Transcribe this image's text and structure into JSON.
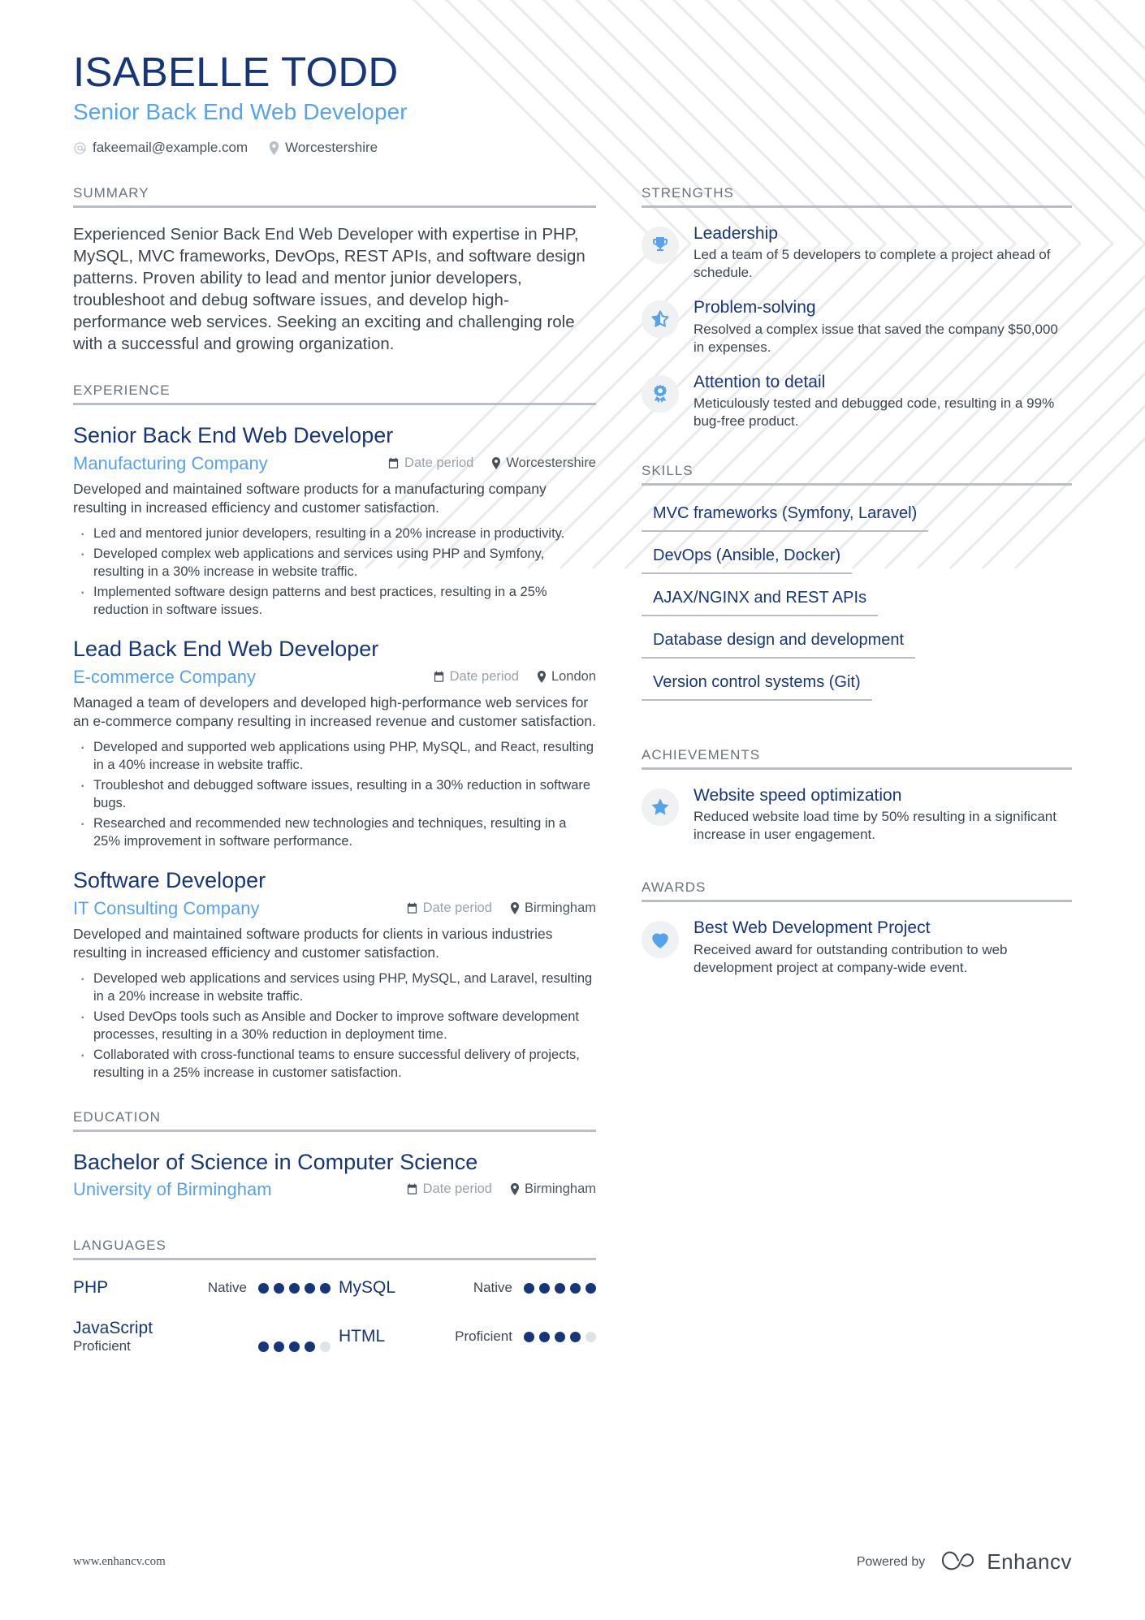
{
  "header": {
    "name": "ISABELLE TODD",
    "job_title": "Senior Back End Web Developer",
    "email": "fakeemail@example.com",
    "location": "Worcestershire",
    "email_icon": "at-icon",
    "location_icon": "map-pin-icon"
  },
  "sections": {
    "summary_label": "SUMMARY",
    "experience_label": "EXPERIENCE",
    "education_label": "EDUCATION",
    "languages_label": "LANGUAGES",
    "strengths_label": "STRENGTHS",
    "skills_label": "SKILLS",
    "achievements_label": "ACHIEVEMENTS",
    "awards_label": "AWARDS"
  },
  "summary": {
    "text": "Experienced Senior Back End Web Developer with expertise in PHP, MySQL, MVC frameworks, DevOps, REST APIs, and software design patterns. Proven ability to lead and mentor junior developers, troubleshoot and debug software issues, and develop high-performance web services. Seeking an exciting and challenging role with a successful and growing organization."
  },
  "experience": [
    {
      "role": "Senior Back End Web Developer",
      "company": "Manufacturing Company",
      "date": "Date period",
      "location": "Worcestershire",
      "summary": "Developed and maintained software products for a manufacturing company resulting in increased efficiency and customer satisfaction.",
      "bullets": [
        "Led and mentored junior developers, resulting in a 20% increase in productivity.",
        "Developed complex web applications and services using PHP and Symfony, resulting in a 30% increase in website traffic.",
        "Implemented software design patterns and best practices, resulting in a 25% reduction in software issues."
      ]
    },
    {
      "role": "Lead Back End Web Developer",
      "company": "E-commerce Company",
      "date": "Date period",
      "location": "London",
      "summary": "Managed a team of developers and developed high-performance web services for an e-commerce company resulting in increased revenue and customer satisfaction.",
      "bullets": [
        "Developed and supported web applications using PHP, MySQL, and React, resulting in a 40% increase in website traffic.",
        "Troubleshot and debugged software issues, resulting in a 30% reduction in software bugs.",
        "Researched and recommended new technologies and techniques, resulting in a 25% improvement in software performance."
      ]
    },
    {
      "role": "Software Developer",
      "company": "IT Consulting Company",
      "date": "Date period",
      "location": "Birmingham",
      "summary": "Developed and maintained software products for clients in various industries resulting in increased efficiency and customer satisfaction.",
      "bullets": [
        "Developed web applications and services using PHP, MySQL, and Laravel, resulting in a 20% increase in website traffic.",
        "Used DevOps tools such as Ansible and Docker to improve software development processes, resulting in a 30% reduction in deployment time.",
        "Collaborated with cross-functional teams to ensure successful delivery of projects, resulting in a 25% increase in customer satisfaction."
      ]
    }
  ],
  "education": [
    {
      "degree": "Bachelor of Science in Computer Science",
      "school": "University of Birmingham",
      "date": "Date period",
      "location": "Birmingham"
    }
  ],
  "languages": [
    {
      "name": "PHP",
      "level": "Native",
      "filled": 5,
      "total": 5,
      "stacked": false
    },
    {
      "name": "MySQL",
      "level": "Native",
      "filled": 5,
      "total": 5,
      "stacked": false
    },
    {
      "name": "JavaScript",
      "level": "Proficient",
      "filled": 4,
      "total": 5,
      "stacked": true
    },
    {
      "name": "HTML",
      "level": "Proficient",
      "filled": 4,
      "total": 5,
      "stacked": false
    }
  ],
  "strengths": [
    {
      "icon": "trophy-icon",
      "title": "Leadership",
      "desc": "Led a team of 5 developers to complete a project ahead of schedule."
    },
    {
      "icon": "star-outline-icon",
      "title": "Problem-solving",
      "desc": "Resolved a complex issue that saved the company $50,000 in expenses."
    },
    {
      "icon": "award-ribbon-icon",
      "title": "Attention to detail",
      "desc": "Meticulously tested and debugged code, resulting in a 99% bug-free product."
    }
  ],
  "skills": [
    "MVC frameworks (Symfony, Laravel)",
    "DevOps (Ansible, Docker)",
    "AJAX/NGINX and REST APIs",
    "Database design and development",
    "Version control systems (Git)"
  ],
  "achievements": [
    {
      "icon": "star-filled-icon",
      "title": "Website speed optimization",
      "desc": "Reduced website load time by 50% resulting in a significant increase in user engagement."
    }
  ],
  "awards": [
    {
      "icon": "heart-icon",
      "title": "Best Web Development Project",
      "desc": "Received award for outstanding contribution to web development project at company-wide event."
    }
  ],
  "footer": {
    "url": "www.enhancv.com",
    "powered_by": "Powered by",
    "brand": "Enhancv",
    "brand_icon": "enhancv-logo-icon"
  },
  "colors": {
    "navy": "#16367a",
    "light_blue": "#56a3ed",
    "rule_gray": "#b9bec4",
    "body_text": "#3d464e"
  }
}
